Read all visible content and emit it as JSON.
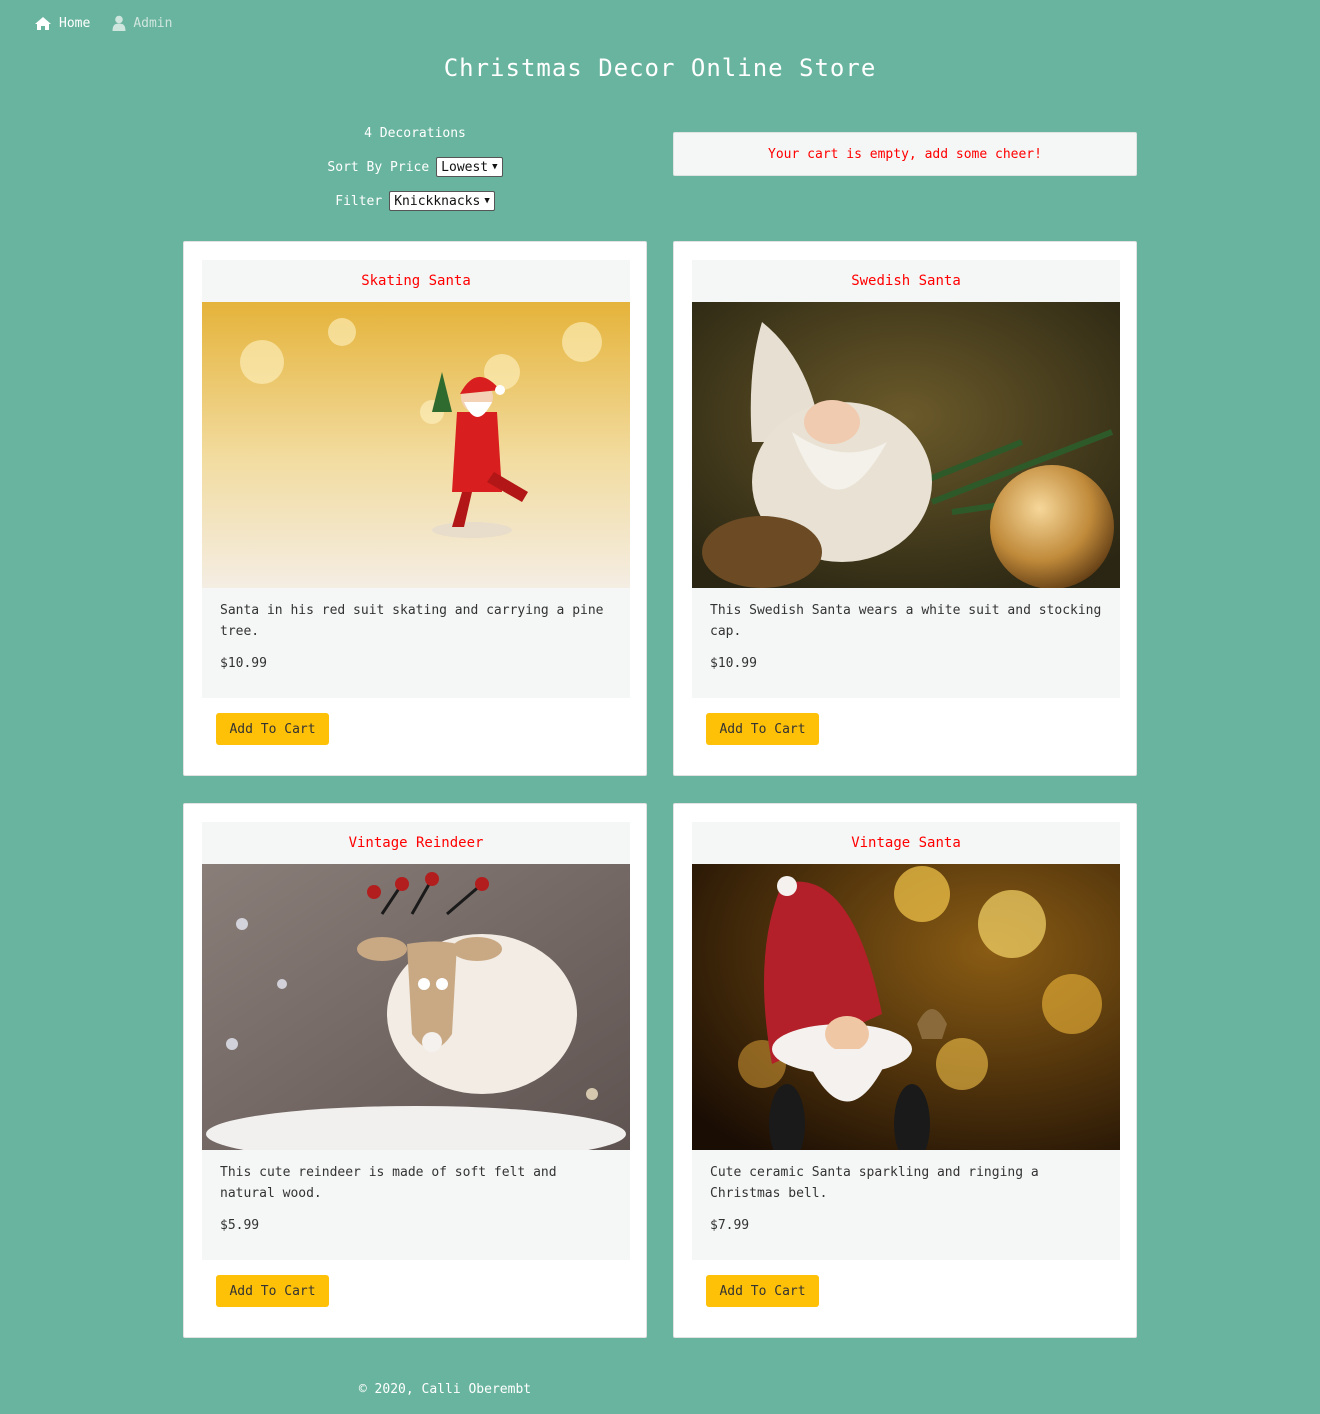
{
  "nav": {
    "home_label": "Home",
    "admin_label": "Admin"
  },
  "page_title": "Christmas Decor Online Store",
  "controls": {
    "count_text": "4 Decorations",
    "sort_label": "Sort By Price",
    "sort_value": "Lowest",
    "filter_label": "Filter",
    "filter_value": "Knickknacks"
  },
  "cart": {
    "message": "Your cart is empty, add some cheer!"
  },
  "products": [
    {
      "name": "Skating Santa",
      "description": "Santa in his red suit skating and carrying a pine tree.",
      "price": "$10.99",
      "button_label": "Add To Cart"
    },
    {
      "name": "Swedish Santa",
      "description": "This Swedish Santa wears a white suit and stocking cap.",
      "price": "$10.99",
      "button_label": "Add To Cart"
    },
    {
      "name": "Vintage Reindeer",
      "description": "This cute reindeer is made of soft felt and natural wood.",
      "price": "$5.99",
      "button_label": "Add To Cart"
    },
    {
      "name": "Vintage Santa",
      "description": "Cute ceramic Santa sparkling and ringing a Christmas bell.",
      "price": "$7.99",
      "button_label": "Add To Cart"
    }
  ],
  "footer": {
    "text": "© 2020, Calli Oberembt"
  },
  "colors": {
    "background": "#69b49e",
    "accent_red": "#ff0000",
    "button_yellow": "#ffc107",
    "panel_gray": "#f5f6f6"
  },
  "icons": {
    "home": "home-icon",
    "admin": "user-icon",
    "dropdown": "chevron-down-icon"
  }
}
